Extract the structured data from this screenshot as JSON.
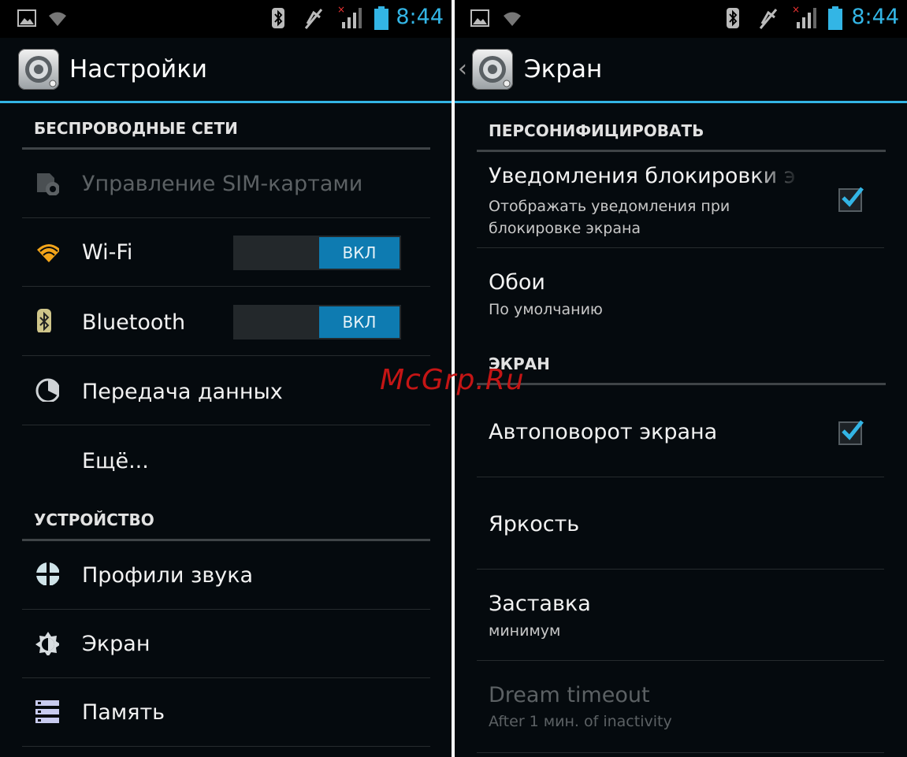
{
  "status_bar": {
    "time": "8:44",
    "icons": [
      "gallery-icon",
      "wifi-icon",
      "bluetooth-icon",
      "mute-icon",
      "signal-icon",
      "battery-icon"
    ]
  },
  "left_screen": {
    "title": "Настройки",
    "sections": [
      {
        "header": "БЕСПРОВОДНЫЕ СЕТИ",
        "items": [
          {
            "label": "Управление SIM-картами",
            "icon": "sim-icon",
            "enabled": false
          },
          {
            "label": "Wi-Fi",
            "icon": "wifi-icon",
            "toggle": "ВКЛ"
          },
          {
            "label": "Bluetooth",
            "icon": "bluetooth-icon",
            "toggle": "ВКЛ"
          },
          {
            "label": "Передача данных",
            "icon": "data-usage-icon"
          },
          {
            "label": "Ещё...",
            "icon": null
          }
        ]
      },
      {
        "header": "УСТРОЙСТВО",
        "items": [
          {
            "label": "Профили звука",
            "icon": "sound-profile-icon"
          },
          {
            "label": "Экран",
            "icon": "display-icon"
          },
          {
            "label": "Память",
            "icon": "storage-icon"
          }
        ]
      }
    ]
  },
  "right_screen": {
    "title": "Экран",
    "sections": [
      {
        "header": "ПЕРСОНИФИЦИРОВАТЬ",
        "items": [
          {
            "title": "Уведомления блокировки экрана",
            "summary": "Отображать уведомления при блокировке экрана",
            "checked": true
          },
          {
            "title": "Обои",
            "summary": "По умолчанию"
          }
        ]
      },
      {
        "header": "ЭКРАН",
        "items": [
          {
            "title": "Автоповорот экрана",
            "checked": true
          },
          {
            "title": "Яркость"
          },
          {
            "title": "Заставка",
            "summary": "минимум"
          },
          {
            "title": "Dream timeout",
            "summary": "After 1 мин. of inactivity",
            "enabled": false
          }
        ]
      }
    ]
  },
  "watermark": "McGrp.Ru",
  "colors": {
    "accent": "#33b5e5",
    "toggle_on": "#0e7bb1",
    "background": "#050a0e",
    "watermark": "#c41515"
  }
}
